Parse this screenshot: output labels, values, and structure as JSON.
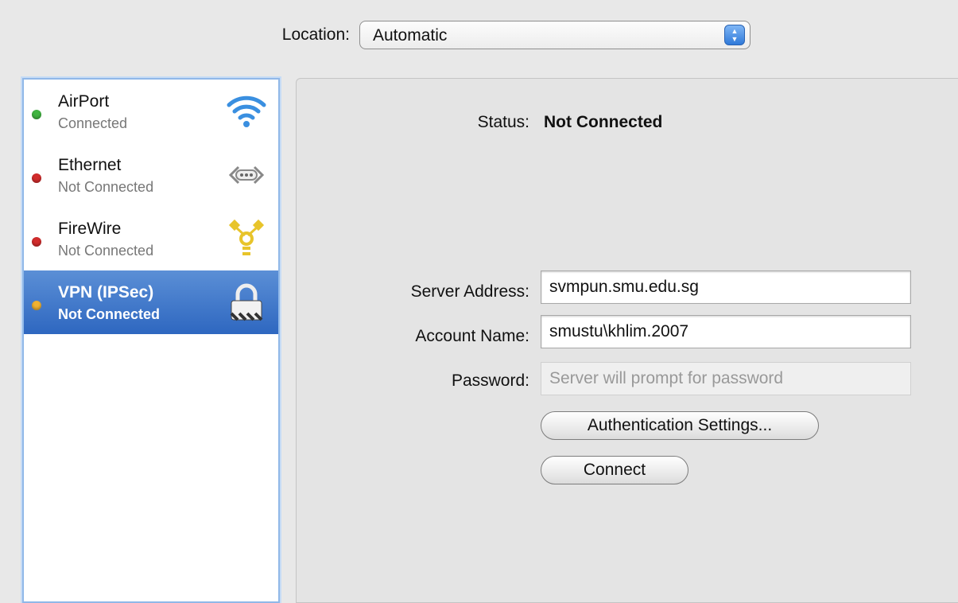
{
  "location": {
    "label": "Location:",
    "value": "Automatic"
  },
  "services": [
    {
      "name": "AirPort",
      "status": "Connected",
      "dot_color": "#3fb43f",
      "icon": "wifi-icon"
    },
    {
      "name": "Ethernet",
      "status": "Not Connected",
      "dot_color": "#d22c2c",
      "icon": "ethernet-icon"
    },
    {
      "name": "FireWire",
      "status": "Not Connected",
      "dot_color": "#d22c2c",
      "icon": "firewire-icon"
    },
    {
      "name": "VPN (IPSec)",
      "status": "Not Connected",
      "dot_color": "#f0b232",
      "icon": "lock-icon",
      "selected": true
    }
  ],
  "detail": {
    "status_label": "Status:",
    "status_value": "Not Connected",
    "server_label": "Server Address:",
    "server_value": "svmpun.smu.edu.sg",
    "account_label": "Account Name:",
    "account_value": "smustu\\khlim.2007",
    "password_label": "Password:",
    "password_placeholder": "Server will prompt for password",
    "auth_button": "Authentication Settings...",
    "connect_button": "Connect"
  },
  "colors": {
    "selection": "#2e67c0",
    "accent": "#2f79d9"
  }
}
